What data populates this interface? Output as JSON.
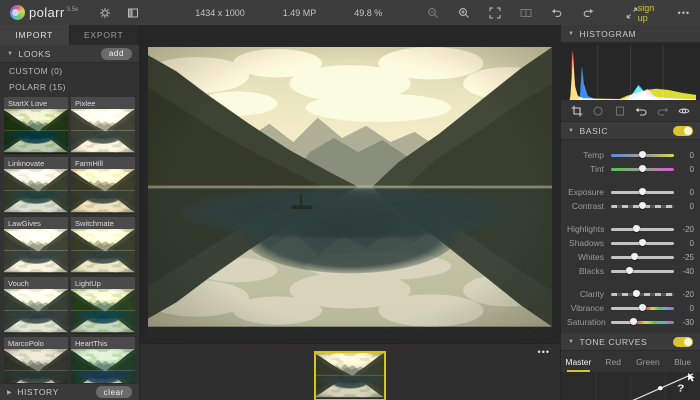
{
  "topbar": {
    "app_name": "polarr",
    "version": "3.5e",
    "dimensions": "1434 x 1000",
    "megapixels": "1.49 MP",
    "zoom_percent": "49.8 %",
    "signup_label": "sign up",
    "more_label": "•••"
  },
  "left": {
    "tabs": [
      {
        "label": "IMPORT",
        "active": true
      },
      {
        "label": "EXPORT",
        "active": false
      }
    ],
    "looks": {
      "title": "LOOKS",
      "add_label": "add",
      "groups": [
        {
          "label": "CUSTOM (0)"
        },
        {
          "label": "POLARR (15)"
        }
      ],
      "filters": [
        "StartX Love",
        "Pixlee",
        "Linknovate",
        "FarmHill",
        "LawGives",
        "Switchmate",
        "Vouch",
        "LightUp",
        "MarcoPolo",
        "HeartThis"
      ]
    },
    "history": {
      "title": "HISTORY",
      "clear_label": "clear"
    }
  },
  "center": {
    "filmstrip_more": "•••"
  },
  "right": {
    "histogram": {
      "title": "HISTOGRAM"
    },
    "tools": [
      "crop",
      "ellipse-mask",
      "rect-mask",
      "undo",
      "redo",
      "show-original"
    ],
    "basic": {
      "title": "BASIC",
      "enabled": true,
      "sliders": [
        {
          "label": "Temp",
          "value": 0,
          "value_display": "0",
          "track": "temp"
        },
        {
          "label": "Tint",
          "value": 0,
          "value_display": "0",
          "track": "tint"
        },
        {
          "label": "Exposure",
          "value": 0,
          "value_display": "0",
          "track": "plain"
        },
        {
          "label": "Contrast",
          "value": 0,
          "value_display": "0",
          "track": "dashed"
        },
        {
          "label": "Highlights",
          "value": -20,
          "value_display": "-20",
          "track": "plain"
        },
        {
          "label": "Shadows",
          "value": 0,
          "value_display": "0",
          "track": "plain"
        },
        {
          "label": "Whites",
          "value": -25,
          "value_display": "-25",
          "track": "plain"
        },
        {
          "label": "Blacks",
          "value": -40,
          "value_display": "-40",
          "track": "plain"
        },
        {
          "label": "Clarity",
          "value": -20,
          "value_display": "-20",
          "track": "dashed"
        },
        {
          "label": "Vibrance",
          "value": 0,
          "value_display": "0",
          "track": "vibrance"
        },
        {
          "label": "Saturation",
          "value": -30,
          "value_display": "-30",
          "track": "saturation"
        }
      ]
    },
    "tone_curves": {
      "title": "TONE CURVES",
      "enabled": true,
      "tabs": [
        "Master",
        "Red",
        "Green",
        "Blue"
      ],
      "active_tab": "Master",
      "cursor": "?"
    }
  },
  "colors": {
    "accent_yellow": "#d8c52e",
    "selected_border": "#d8c41f",
    "topbar_bg": "#3d3d3d",
    "panel_bg": "#333333",
    "canvas_bg": "#262626"
  }
}
